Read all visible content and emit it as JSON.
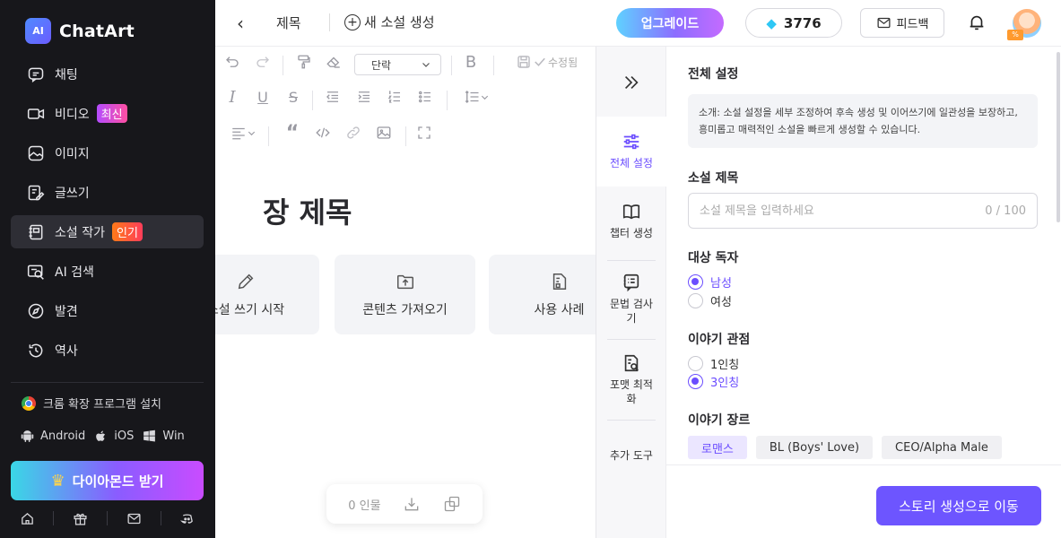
{
  "app": {
    "name": "ChatArt",
    "logo_mark": "AI"
  },
  "sidebar": {
    "items": [
      {
        "label": "채팅",
        "icon": "chat-icon"
      },
      {
        "label": "비디오",
        "icon": "video-icon",
        "badge": "최신"
      },
      {
        "label": "이미지",
        "icon": "image-icon"
      },
      {
        "label": "글쓰기",
        "icon": "write-icon"
      },
      {
        "label": "소설 작가",
        "icon": "book-icon",
        "badge": "인기",
        "active": true
      },
      {
        "label": "AI 검색",
        "icon": "ai-search-icon"
      },
      {
        "label": "발견",
        "icon": "compass-icon"
      },
      {
        "label": "역사",
        "icon": "history-icon"
      }
    ],
    "extension_label": "크롬 확장 프로그램 설치",
    "platforms": [
      "Android",
      "iOS",
      "Win"
    ],
    "diamond_button": "다이아몬드 받기"
  },
  "header": {
    "doc_title": "제목",
    "new_novel": "새 소설 생성",
    "upgrade": "업그레이드",
    "credits": "3776",
    "feedback": "피드백"
  },
  "editor": {
    "paragraph_style": "단락",
    "saved": "수정됨",
    "chapter_title": "장 제목",
    "cards": [
      {
        "label": "소설 쓰기 시작",
        "icon": "pencil-icon"
      },
      {
        "label": "콘텐츠 가져오기",
        "icon": "folder-upload-icon"
      },
      {
        "label": "사용 사례",
        "icon": "document-icon"
      }
    ],
    "char_count": "0 인물"
  },
  "tabs": [
    {
      "label": "전체 설정",
      "icon": "sliders-icon",
      "active": true
    },
    {
      "label": "챕터 생성",
      "icon": "open-book-icon"
    },
    {
      "label": "문법 검사기",
      "icon": "grammar-check-icon"
    },
    {
      "label": "포맷 최적화",
      "icon": "format-icon"
    },
    {
      "label": "추가 도구",
      "icon": "tools-icon"
    }
  ],
  "settings": {
    "heading": "전체 설정",
    "intro": "소개: 소설 설정을 세부 조정하여 후속 생성 및 이어쓰기에 일관성을 보장하고, 흥미롭고 매력적인 소설을 빠르게 생성할 수 있습니다.",
    "novel_title_label": "소설 제목",
    "novel_title_placeholder": "소설 제목을 입력하세요",
    "novel_title_count": "0 / 100",
    "audience_label": "대상 독자",
    "audience_options": [
      "남성",
      "여성"
    ],
    "audience_selected": "남성",
    "pov_label": "이야기 관점",
    "pov_options": [
      "1인칭",
      "3인칭"
    ],
    "pov_selected": "3인칭",
    "genre_label": "이야기 장르",
    "genres": [
      "로맨스",
      "BL (Boys' Love)",
      "CEO/Alpha Male"
    ],
    "genre_selected": "로맨스"
  },
  "footer": {
    "go_button": "스토리 생성으로 이동"
  },
  "colors": {
    "accent": "#6d55ff",
    "sidebar_bg": "#17171b"
  }
}
